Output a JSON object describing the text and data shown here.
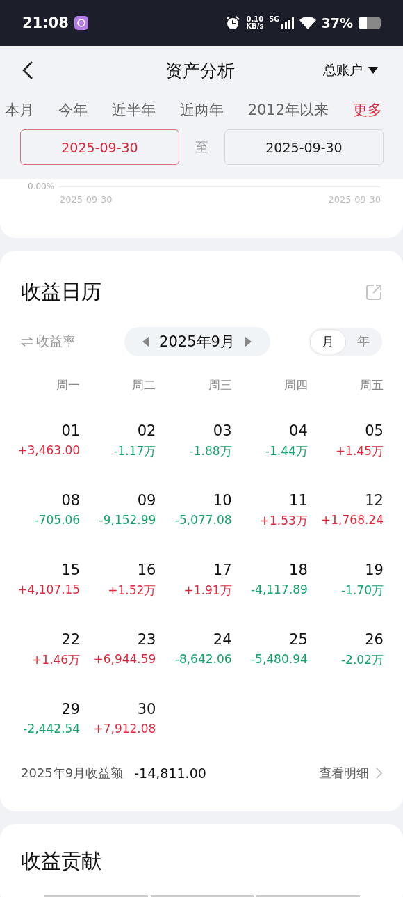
{
  "status_bar": {
    "time": "21:08",
    "net_speed": "0.10",
    "net_unit": "KB/s",
    "network": "5G",
    "battery": "37%"
  },
  "header": {
    "title": "资产分析",
    "account": "总账户"
  },
  "ranges": [
    {
      "label": "本月",
      "selected": false
    },
    {
      "label": "今年",
      "selected": false
    },
    {
      "label": "近半年",
      "selected": false
    },
    {
      "label": "近两年",
      "selected": false
    },
    {
      "label": "2012年以来",
      "selected": false
    },
    {
      "label": "更多",
      "selected": true
    }
  ],
  "date_range": {
    "start": {
      "value": "2025-09-30",
      "selected": true
    },
    "separator": "至",
    "end": {
      "value": "2025-09-30",
      "selected": false
    }
  },
  "chart_fragment": {
    "y_label": "0.00%",
    "x_labels": [
      "2025-09-30",
      "2025-09-30"
    ]
  },
  "calendar": {
    "title": "收益日历",
    "metric_toggle": "收益率",
    "month": "2025年9月",
    "views": [
      {
        "label": "月",
        "selected": true
      },
      {
        "label": "年",
        "selected": false
      }
    ],
    "weekdays": [
      "周一",
      "周二",
      "周三",
      "周四",
      "周五"
    ],
    "weeks": [
      [
        {
          "day": "01",
          "amount": "+3,463.00",
          "color": "#e0283c"
        },
        {
          "day": "02",
          "amount": "-1.17万",
          "color": "#12a36a"
        },
        {
          "day": "03",
          "amount": "-1.88万",
          "color": "#12a36a"
        },
        {
          "day": "04",
          "amount": "-1.44万",
          "color": "#12a36a"
        },
        {
          "day": "05",
          "amount": "+1.45万",
          "color": "#e0283c"
        }
      ],
      [
        {
          "day": "08",
          "amount": "-705.06",
          "color": "#12a36a"
        },
        {
          "day": "09",
          "amount": "-9,152.99",
          "color": "#12a36a"
        },
        {
          "day": "10",
          "amount": "-5,077.08",
          "color": "#12a36a"
        },
        {
          "day": "11",
          "amount": "+1.53万",
          "color": "#e0283c"
        },
        {
          "day": "12",
          "amount": "+1,768.24",
          "color": "#e0283c"
        }
      ],
      [
        {
          "day": "15",
          "amount": "+4,107.15",
          "color": "#e0283c"
        },
        {
          "day": "16",
          "amount": "+1.52万",
          "color": "#e0283c"
        },
        {
          "day": "17",
          "amount": "+1.91万",
          "color": "#e0283c"
        },
        {
          "day": "18",
          "amount": "-4,117.89",
          "color": "#12a36a"
        },
        {
          "day": "19",
          "amount": "-1.70万",
          "color": "#12a36a"
        }
      ],
      [
        {
          "day": "22",
          "amount": "+1.46万",
          "color": "#e0283c"
        },
        {
          "day": "23",
          "amount": "+6,944.59",
          "color": "#e0283c"
        },
        {
          "day": "24",
          "amount": "-8,642.06",
          "color": "#12a36a"
        },
        {
          "day": "25",
          "amount": "-5,480.94",
          "color": "#12a36a"
        },
        {
          "day": "26",
          "amount": "-2.02万",
          "color": "#12a36a"
        }
      ],
      [
        {
          "day": "29",
          "amount": "-2,442.54",
          "color": "#12a36a"
        },
        {
          "day": "30",
          "amount": "+7,912.08",
          "color": "#e0283c"
        }
      ]
    ],
    "summary_label": "2025年9月收益额",
    "summary_value": "-14,811.00",
    "details_link": "查看明细"
  },
  "contribution": {
    "title": "收益贡献"
  }
}
